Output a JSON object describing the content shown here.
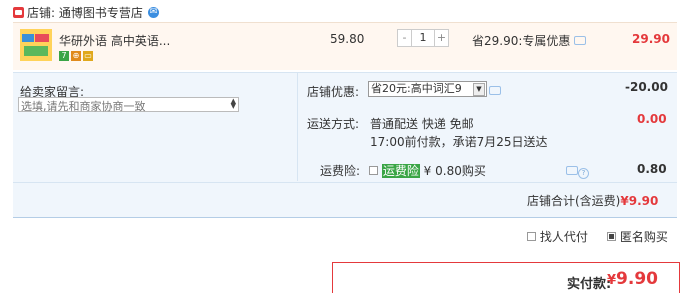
{
  "shop": {
    "name": "店铺: 通博图书专营店"
  },
  "item": {
    "title": "华研外语 高中英语...",
    "badges": [
      {
        "text": "7",
        "color": "#3aa546"
      },
      {
        "text": "⊕",
        "color": "#e08a1c"
      },
      {
        "text": "▭",
        "color": "#e0a81c"
      }
    ],
    "unit_price": "59.80",
    "quantity": "1",
    "discount_text": "省29.90:专属优惠",
    "total": "29.90"
  },
  "message": {
    "label": "给卖家留言:",
    "placeholder": "选填,请先和商家协商一致"
  },
  "shop_discount": {
    "label": "店铺优惠:",
    "selected": "省20元:高中词汇9",
    "amount": "-20.00"
  },
  "shipping": {
    "label": "运送方式:",
    "method": "普通配送 快递 免邮",
    "eta": "17:00前付款，承诺7月25日送达",
    "amount": "0.00"
  },
  "insurance": {
    "label": "运费险:",
    "badge": "运费险",
    "price_text": "¥ 0.80购买",
    "amount": "0.80"
  },
  "subtotal": {
    "label": "店铺合计(含运费)",
    "value": "¥9.90"
  },
  "options": {
    "proxy_pay": "找人代付",
    "anonymous": "匿名购买"
  },
  "payment": {
    "label": "实付款:",
    "currency": "¥",
    "value": "9.90"
  },
  "colors": {
    "accent": "#e4393c",
    "panel": "#f0f6fc"
  }
}
